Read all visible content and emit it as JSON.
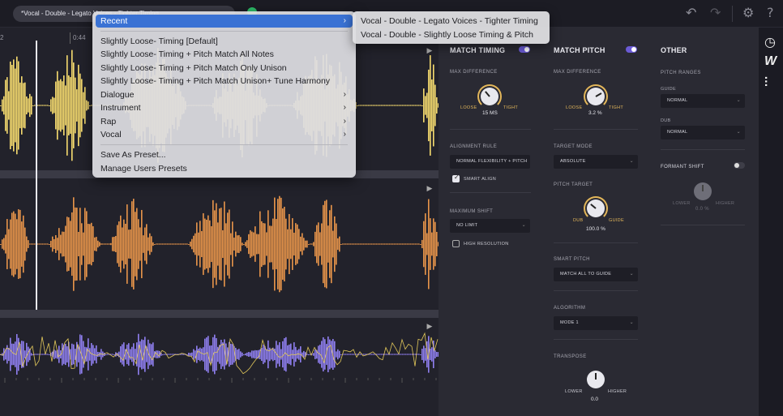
{
  "topbar": {
    "preset_name": "*Vocal - Double - Legato Voices - Tighter Timing",
    "undo_icon": "undo-icon",
    "redo_icon": "redo-icon",
    "settings_icon": "gear-icon",
    "help_icon": "help-icon"
  },
  "timeline": {
    "marker_a": "2",
    "marker_b": "0:44"
  },
  "lanes": [
    {
      "name": "guide",
      "color": "#f7dc6f"
    },
    {
      "name": "dub",
      "color": "#e8954a"
    },
    {
      "name": "output",
      "color": "#8f7ff0"
    }
  ],
  "menu": {
    "recent": "Recent",
    "items": [
      "Slightly Loose- Timing [Default]",
      "Slightly Loose- Timing + Pitch Match All Notes",
      "Slightly Loose- Timing + Pitch Match Only Unison",
      "Slightly Loose- Timing + Pitch Match Unison+ Tune Harmony"
    ],
    "categories": [
      "Dialogue",
      "Instrument",
      "Rap",
      "Vocal"
    ],
    "save_as": "Save As Preset...",
    "manage": "Manage Users Presets"
  },
  "submenu": {
    "items": [
      "Vocal - Double - Legato Voices - Tighter Timing",
      "Vocal - Double - Slightly Loose Timing & Pitch"
    ]
  },
  "timing": {
    "title": "MATCH TIMING",
    "max_diff_label": "MAX DIFFERENCE",
    "loose": "LOOSE",
    "tight": "TIGHT",
    "max_diff_value": "15 MS",
    "alignment_label": "ALIGNMENT RULE",
    "alignment_value": "NORMAL FLEXIBILITY + PITCH",
    "smart_align": "SMART ALIGN",
    "max_shift_label": "MAXIMUM SHIFT",
    "max_shift_value": "NO LIMIT",
    "high_res": "HIGH RESOLUTION"
  },
  "pitch": {
    "title": "MATCH PITCH",
    "max_diff_label": "MAX DIFFERENCE",
    "loose": "LOOSE",
    "tight": "TIGHT",
    "max_diff_value": "3.2 %",
    "target_mode_label": "TARGET MODE",
    "target_mode_value": "ABSOLUTE",
    "pitch_target_label": "PITCH TARGET",
    "dub": "DUB",
    "guide": "GUIDE",
    "pitch_target_value": "100.0 %",
    "smart_pitch_label": "SMART PITCH",
    "smart_pitch_value": "MATCH ALL TO GUIDE",
    "algorithm_label": "ALGORITHM",
    "algorithm_value": "MODE 1",
    "transpose_label": "TRANSPOSE",
    "lower": "LOWER",
    "higher": "HIGHER",
    "transpose_value": "0.0"
  },
  "other": {
    "title": "OTHER",
    "pitch_ranges_label": "PITCH RANGES",
    "guide_label": "GUIDE",
    "guide_value": "NORMAL",
    "dub_label": "DUB",
    "dub_value": "NORMAL",
    "formant_label": "FORMANT SHIFT",
    "lower": "LOWER",
    "higher": "HIGHER",
    "formant_value": "0.0 %"
  },
  "sidebar": {
    "icons": [
      "clock-icon",
      "w-logo-icon",
      "sliders-icon"
    ]
  }
}
